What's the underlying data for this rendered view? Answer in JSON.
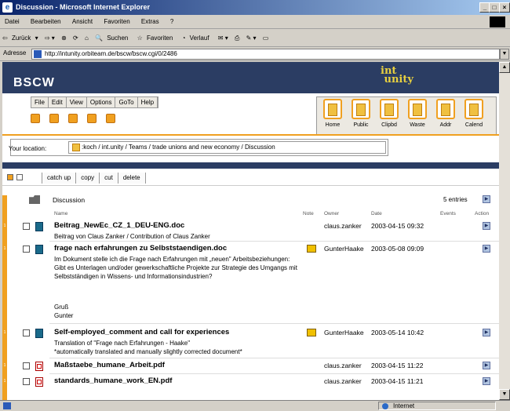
{
  "window": {
    "title": "Discussion - Microsoft Internet Explorer"
  },
  "menu": [
    "Datei",
    "Bearbeiten",
    "Ansicht",
    "Favoriten",
    "Extras",
    "?"
  ],
  "toolbar": {
    "back": "Zurück",
    "search": "Suchen",
    "favorites": "Favoriten",
    "history": "Verlauf"
  },
  "address": {
    "label": "Adresse",
    "url": "http://intunity.orbiteam.de/bscw/bscw.cgi/0/2486"
  },
  "status": {
    "zone": "Internet"
  },
  "bscw": {
    "logo": "BSCW",
    "brand": "int unity",
    "menu": [
      "File",
      "Edit",
      "View",
      "Options",
      "GoTo",
      "Help"
    ],
    "nav": [
      "Home",
      "Public",
      "Clipbd",
      "Waste",
      "Addr",
      "Calend"
    ],
    "location_label": "Your location:",
    "location_path": ":koch / int.unity / Teams / trade unions and new economy / Discussion",
    "actions": [
      "catch up",
      "copy",
      "cut",
      "delete"
    ],
    "folder": "Discussion",
    "entries": "5 entries",
    "columns": {
      "name": "Name",
      "note": "Note",
      "owner": "Owner",
      "date": "Date",
      "events": "Events",
      "action": "Action"
    },
    "rows": [
      {
        "title": "Beitrag_NewEc_CZ_1_DEU-ENG.doc",
        "desc": "Beitrag von Claus Zanker / Contribution of Claus Zanker",
        "owner": "claus.zanker",
        "date": "2003-04-15 09:32",
        "icon": "doc-icon"
      },
      {
        "title": "frage nach erfahrungen zu Selbststaendigen.doc",
        "desc": "Im Dokument stelle ich die Frage nach Erfahrungen mit „neuen\" Arbeitsbeziehungen: Gibt es Unterlagen und/oder gewerkschaftliche Projekte zur Strategie des Umgangs mit Selbstständigen in Wissens- und Informationsindustrien?",
        "desc2": "Gruß",
        "desc3": "Gunter",
        "owner": "GunterHaake",
        "date": "2003-05-08 09:09",
        "icon": "doc-icon"
      },
      {
        "title": "Self-employed_comment and call for experiences",
        "desc": "Translation of \"Frage nach Erfahrungen - Haake\"",
        "desc2": "*automatically translated and manually slightly corrected document*",
        "owner": "GunterHaake",
        "date": "2003-05-14 10:42",
        "icon": "doc-icon"
      },
      {
        "title": "Maßstaebe_humane_Arbeit.pdf",
        "owner": "claus.zanker",
        "date": "2003-04-15 11:22",
        "icon": "pdf-icon"
      },
      {
        "title": "standards_humane_work_EN.pdf",
        "owner": "claus.zanker",
        "date": "2003-04-15 11:21",
        "icon": "pdf-icon"
      }
    ]
  }
}
